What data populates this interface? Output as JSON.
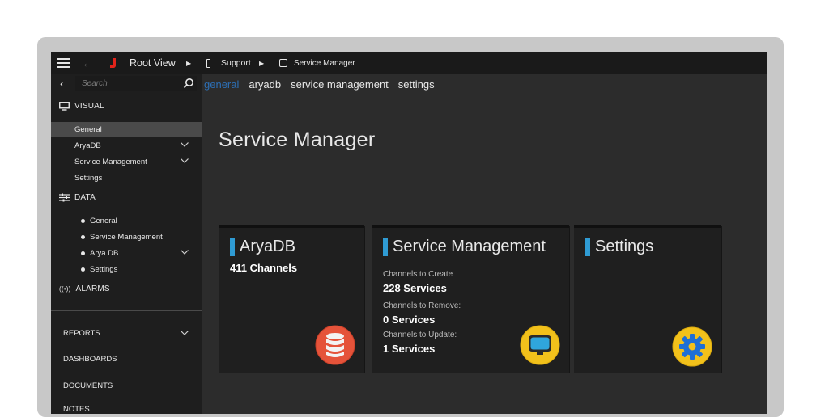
{
  "topbar": {
    "root_label": "Root View",
    "support_label": "Support",
    "service_manager_label": "Service Manager"
  },
  "sidebar": {
    "search_placeholder": "Search",
    "visual": {
      "label": "VISUAL",
      "items": [
        {
          "label": "General",
          "active": true
        },
        {
          "label": "AryaDB",
          "expandable": true
        },
        {
          "label": "Service Management",
          "expandable": true
        },
        {
          "label": "Settings"
        }
      ]
    },
    "data": {
      "label": "DATA",
      "items": [
        {
          "label": "General"
        },
        {
          "label": "Service Management"
        },
        {
          "label": "Arya DB",
          "expandable": true
        },
        {
          "label": "Settings"
        }
      ]
    },
    "alarms_label": "ALARMS",
    "lower_items": [
      {
        "label": "REPORTS",
        "expandable": true
      },
      {
        "label": "DASHBOARDS"
      },
      {
        "label": "DOCUMENTS"
      },
      {
        "label": "NOTES"
      }
    ]
  },
  "tabs": [
    {
      "label": "general",
      "active": true
    },
    {
      "label": "aryadb"
    },
    {
      "label": "service management"
    },
    {
      "label": "settings"
    }
  ],
  "main": {
    "title": "Service Manager",
    "cards": {
      "aryadb": {
        "title": "AryaDB",
        "subtitle": "411 Channels",
        "icon": "database-icon"
      },
      "service_management": {
        "title": "Service Management",
        "stats": [
          {
            "label": "Channels to Create",
            "value": "228 Services"
          },
          {
            "label": "Channels to Remove:",
            "value": "0 Services"
          },
          {
            "label": "Channels to Update:",
            "value": "1 Services"
          }
        ],
        "icon": "monitor-icon"
      },
      "settings": {
        "title": "Settings",
        "icon": "gear-icon"
      }
    }
  },
  "colors": {
    "accent_blue": "#2f9bd3",
    "active_tab": "#2d6fb5",
    "root_icon_red": "#e2231a",
    "sidebar_bg": "#1e1e1e",
    "main_bg": "#2c2c2c"
  }
}
